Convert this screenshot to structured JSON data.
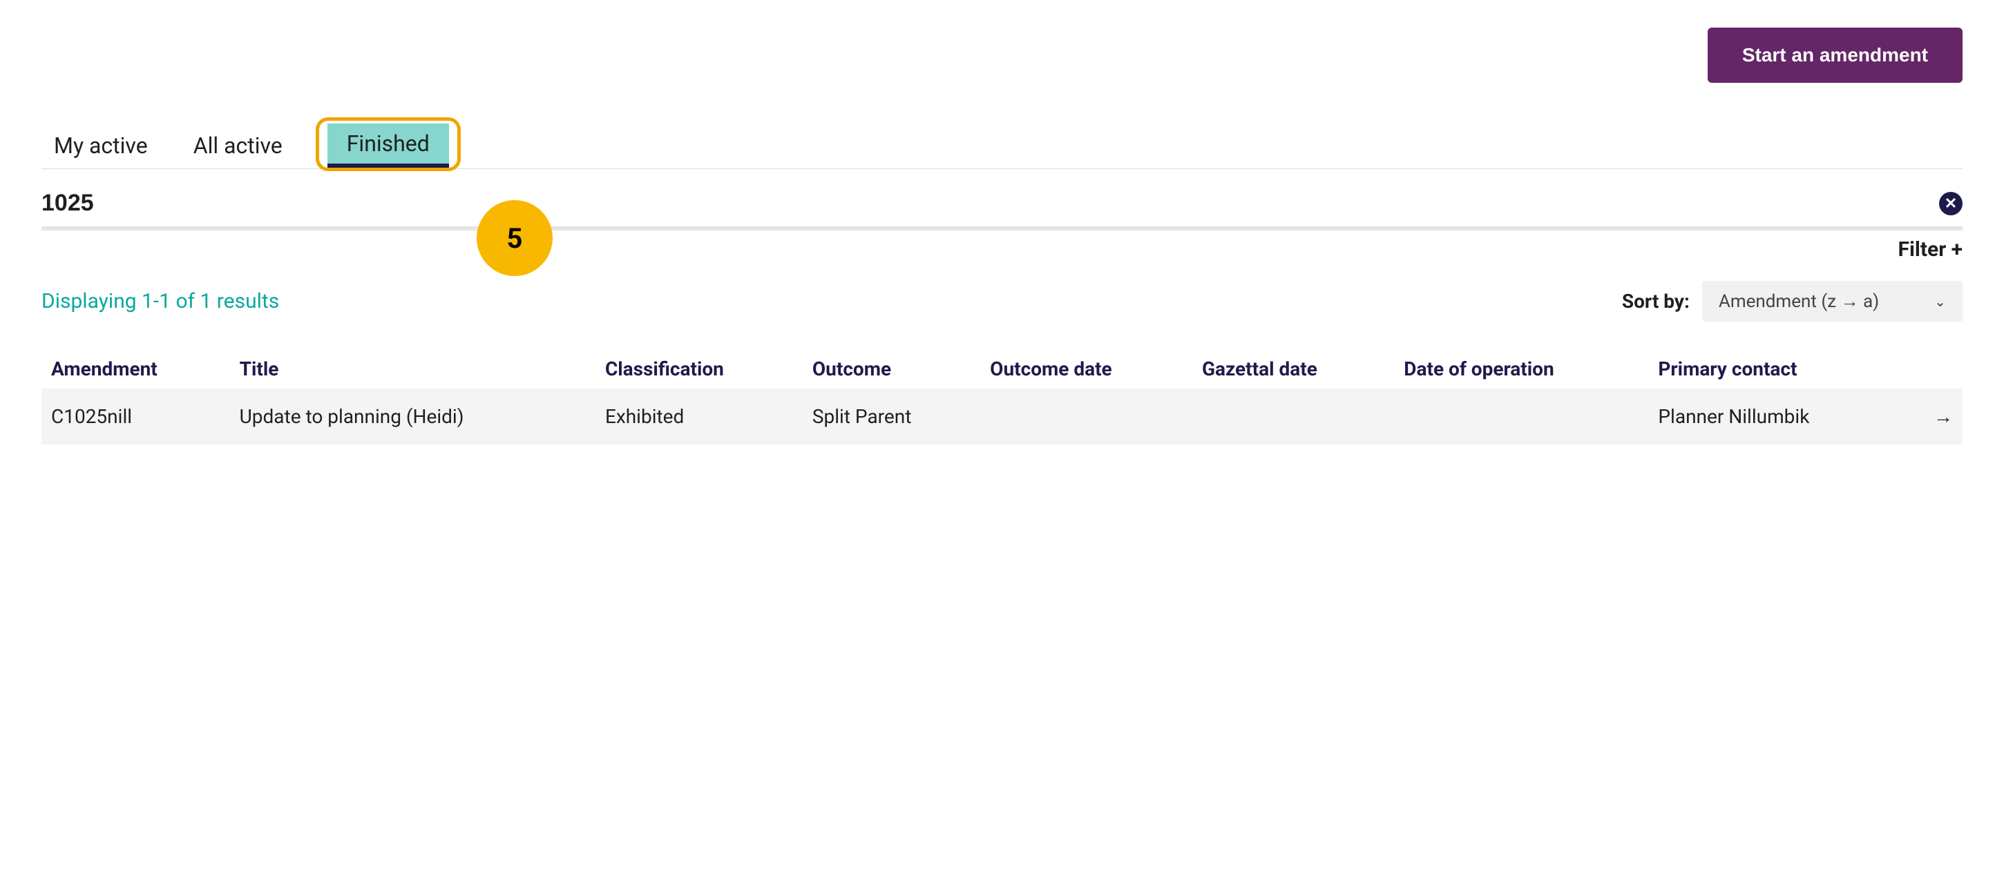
{
  "actions": {
    "start_label": "Start an amendment"
  },
  "tabs": {
    "my_active": "My active",
    "all_active": "All active",
    "finished": "Finished"
  },
  "search": {
    "value": "1025"
  },
  "annotation": {
    "badge": "5"
  },
  "filter": {
    "label": "Filter +"
  },
  "results": {
    "summary": "Displaying 1-1 of 1 results"
  },
  "sort": {
    "label": "Sort by:",
    "selected": "Amendment (z → a)"
  },
  "table": {
    "headers": {
      "amendment": "Amendment",
      "title": "Title",
      "classification": "Classification",
      "outcome": "Outcome",
      "outcome_date": "Outcome date",
      "gazettal_date": "Gazettal date",
      "date_of_operation": "Date of operation",
      "primary_contact": "Primary contact"
    },
    "rows": [
      {
        "amendment": "C1025nill",
        "title": "Update to planning (Heidi)",
        "classification": "Exhibited",
        "outcome": "Split Parent",
        "outcome_date": "",
        "gazettal_date": "",
        "date_of_operation": "",
        "primary_contact": "Planner Nillumbik"
      }
    ]
  }
}
